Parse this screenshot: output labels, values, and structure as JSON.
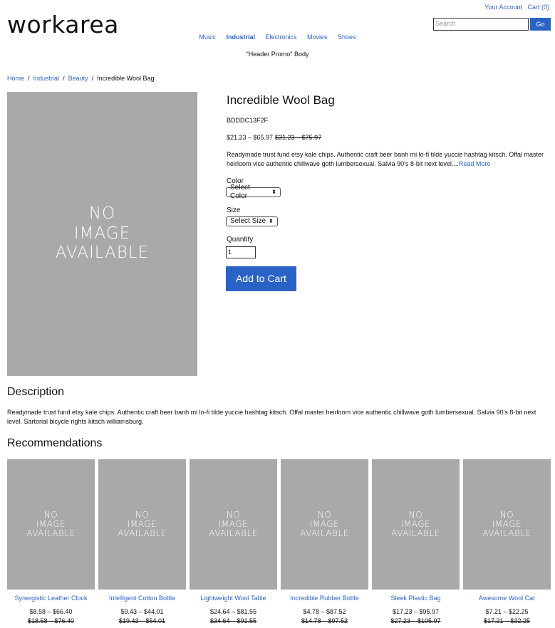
{
  "brand": {
    "logo_text": "workarea"
  },
  "utility": {
    "account": "Your Account",
    "cart": "Cart (0)"
  },
  "search": {
    "placeholder": "Search",
    "button": "Go"
  },
  "nav": {
    "items": [
      "Music",
      "Industrial",
      "Electronics",
      "Movies",
      "Shoes"
    ],
    "active": "Industrial"
  },
  "promo": {
    "text": "\"Header Promo\" Body"
  },
  "breadcrumb": {
    "items": [
      "Home",
      "Industrial",
      "Beauty",
      "Incredible Wool Bag"
    ]
  },
  "no_image": {
    "line1": "NO",
    "line2": "IMAGE",
    "line3": "AVAILABLE"
  },
  "product": {
    "title": "Incredible Wool Bag",
    "sku": "BDDDC13F2F",
    "price_range": "$21.23 – $65.97",
    "original_range": "$31.23 – $75.97",
    "short_description": "Readymade trust fund etsy kale chips. Authentic craft beer banh mi lo-fi tilde yuccie hashtag kitsch. Offal master heirloom vice authentic chillwave goth lumbersexual. Salvia 90's 8-bit next level....",
    "read_more": "Read More",
    "color_label": "Color",
    "color_value": "Select Color",
    "size_label": "Size",
    "size_value": "Select Size",
    "quantity_label": "Quantity",
    "quantity_value": "1",
    "add_to_cart": "Add to Cart"
  },
  "description": {
    "heading": "Description",
    "text": "Readymade trust fund etsy kale chips. Authentic craft beer banh mi lo-fi tilde yuccie hashtag kitsch. Offal master heirloom vice authentic chillwave goth lumbersexual. Salvia 90's 8-bit next level. Sartorial bicycle rights kitsch williamsburg."
  },
  "recommendations": {
    "heading": "Recommendations",
    "items": [
      {
        "name": "Synergistic Leather Clock",
        "price": "$8.58 – $66.40",
        "original": "$18.58 – $76.40"
      },
      {
        "name": "Intelligent Cotton Bottle",
        "price": "$9.43 – $44.01",
        "original": "$19.43 – $54.01"
      },
      {
        "name": "Lightweight Wool Table",
        "price": "$24.64 – $81.55",
        "original": "$34.64 – $91.55"
      },
      {
        "name": "Incredible Rubber Bottle",
        "price": "$4.78 – $87.52",
        "original": "$14.78 – $97.52"
      },
      {
        "name": "Sleek Plastic Bag",
        "price": "$17.23 – $95.97",
        "original": "$27.23 – $105.97"
      },
      {
        "name": "Awesome Wool Car",
        "price": "$7.21 – $22.25",
        "original": "$17.21 – $32.25"
      }
    ]
  },
  "colors": {
    "accent": "#2a63c6",
    "placeholder_gray": "#a9a9a9"
  }
}
